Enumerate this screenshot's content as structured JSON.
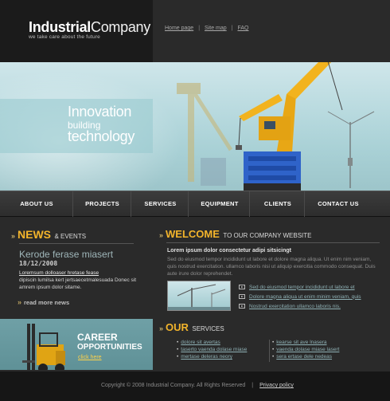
{
  "header": {
    "logo_bold": "Industrial",
    "logo_light": "Company",
    "tagline": "we take care about the future",
    "links": [
      "Home page",
      "Site map",
      "FAQ"
    ]
  },
  "banner": {
    "line1": "Innovation",
    "line2": "building",
    "line3": "technology"
  },
  "nav": [
    "ABOUT US",
    "PROJECTS",
    "SERVICES",
    "EQUIPMENT",
    "CLIENTS",
    "CONTACT US"
  ],
  "news": {
    "heading_big": "NEWS",
    "heading_small": "& EVENTS",
    "title": "Kerode ferase miasert",
    "date": "18/12/2008",
    "link": "Loremsum dolloaser hretase fease",
    "body": "dipiscin lumilsa kert jertsaecetmalesuada Donec sit amrem ipsum dolor sitame.",
    "read_more": "read more news"
  },
  "career": {
    "line1": "CAREER",
    "line2": "OPPORTUNITIES",
    "link": "click here"
  },
  "welcome": {
    "heading_big": "WELCOME",
    "heading_small": "TO OUR COMPANY WEBSITE",
    "lead": "Lorem ipsum dolor consectetur adipi sitsicingt",
    "body": "Sed do eiusmod tempor incididunt ut labore et dolore magna aliqua. Ut enim nim veniam, quis nostrud exercitation. ullamco laboris nisi ut aliquip exercitia commodo consequat. Duis aute irure dolor reprehendet.",
    "links": [
      "Sed do eiusmod tempor incididunt ut labore et",
      "Dolore magna aliqua ut enim minim veniam, quis",
      "Nostrud exercitation ullamco laboris nis."
    ]
  },
  "services": {
    "heading_big": "OUR",
    "heading_small": "SERVICES",
    "col1": [
      "dolore sit avertas",
      "taserto vaenda dolase miase",
      "mertase deleras neory"
    ],
    "col2": [
      "kearse sit ave lnasera",
      "vaenda dolase miase lasert",
      "sera ertase dele nedeas"
    ]
  },
  "footer": {
    "copyright": "Copyright © 2008 Industrial Company. All Rights Reserved",
    "privacy": "Privacy policy"
  },
  "colors": {
    "accent": "#f3b42b",
    "link": "#8fb1b5",
    "background": "#2a2a2a"
  }
}
